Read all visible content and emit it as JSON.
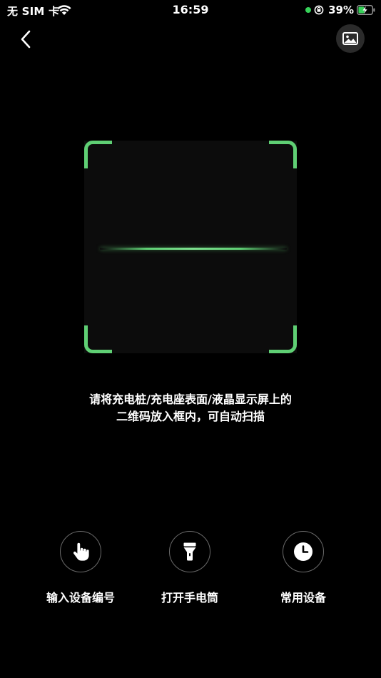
{
  "status_bar": {
    "carrier": "无 SIM 卡",
    "time": "16:59",
    "battery": "39%"
  },
  "nav": {
    "back_icon": "chevron-left-icon",
    "album_icon": "image-icon"
  },
  "scanner": {
    "accent_color": "#5fcf74",
    "hint_line1": "请将充电桩/充电座表面/液晶显示屏上的",
    "hint_line2": "二维码放入框内，可自动扫描"
  },
  "actions": [
    {
      "label": "输入设备编号",
      "icon": "tap-hand-icon"
    },
    {
      "label": "打开手电筒",
      "icon": "flashlight-icon"
    },
    {
      "label": "常用设备",
      "icon": "clock-icon"
    }
  ]
}
